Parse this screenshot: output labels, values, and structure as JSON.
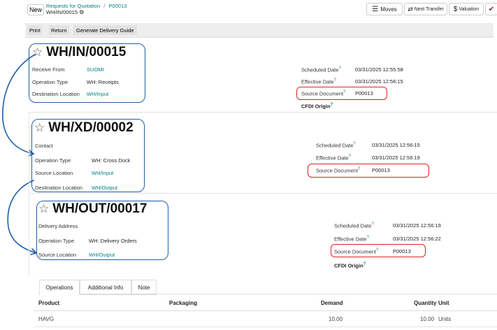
{
  "header": {
    "new_label": "New",
    "breadcrumb_parent": "Requests for Quotation",
    "breadcrumb_sep": "/",
    "breadcrumb_current": "P00013",
    "record_name": "WH/IN/00015",
    "gear_glyph": "⚙",
    "moves_label": "Moves",
    "next_transfer_label": "Next Transfer",
    "valuation_label": "Valuation"
  },
  "toolbar": {
    "print": "Print",
    "return": "Return",
    "generate_delivery_guide": "Generate Delivery Guide"
  },
  "rec1": {
    "title": "WH/IN/00015",
    "receive_from_label": "Receive From",
    "receive_from_value": "SUOMI",
    "operation_type_label": "Operation Type",
    "operation_type_value": "WH: Receipts",
    "destination_location_label": "Destination Location",
    "destination_location_value": "WH/Input",
    "scheduled_date_label": "Scheduled Date",
    "scheduled_date_value": "03/31/2025 12:55:58",
    "effective_date_label": "Effective Date",
    "effective_date_value": "03/31/2025 12:56:15",
    "source_document_label": "Source Document",
    "source_document_value": "P00013",
    "cfdi_origin_label": "CFDI Origin"
  },
  "rec2": {
    "title": "WH/XD/00002",
    "contact_label": "Contact",
    "operation_type_label": "Operation Type",
    "operation_type_value": "WH: Cross Dock",
    "source_location_label": "Source Location",
    "source_location_value": "WH/Input",
    "destination_location_label": "Destination Location",
    "destination_location_value": "WH/Output",
    "scheduled_date_label": "Scheduled Date",
    "scheduled_date_value": "03/31/2025 12:56:15",
    "effective_date_label": "Effective Date",
    "effective_date_value": "03/31/2025 12:56:19",
    "source_document_label": "Source Document",
    "source_document_value": "P00013"
  },
  "rec3": {
    "title": "WH/OUT/00017",
    "delivery_address_label": "Delivery Address",
    "operation_type_label": "Operation Type",
    "operation_type_value": "WH: Delivery Orders",
    "source_location_label": "Source Location",
    "source_location_value": "WH/Output",
    "scheduled_date_label": "Scheduled Date",
    "scheduled_date_value": "03/31/2025 12:56:19",
    "effective_date_label": "Effective Date",
    "effective_date_value": "03/31/2025 12:56:22",
    "source_document_label": "Source Document",
    "source_document_value": "P00013",
    "cfdi_origin_label": "CFDI Origin"
  },
  "tabs": {
    "operations": "Operations",
    "additional_info": "Additional Info",
    "note": "Note"
  },
  "table": {
    "headers": {
      "product": "Product",
      "packaging": "Packaging",
      "demand": "Demand",
      "quantity": "Quantity",
      "unit": "Unit"
    },
    "rows": [
      {
        "product": "HAVG",
        "packaging": "",
        "demand": "10.00",
        "quantity": "10.00",
        "unit": "Units"
      }
    ]
  },
  "colors": {
    "accent": "#017e84",
    "annotation_blue": "#1f5fa6",
    "annotation_red": "#d22222"
  }
}
